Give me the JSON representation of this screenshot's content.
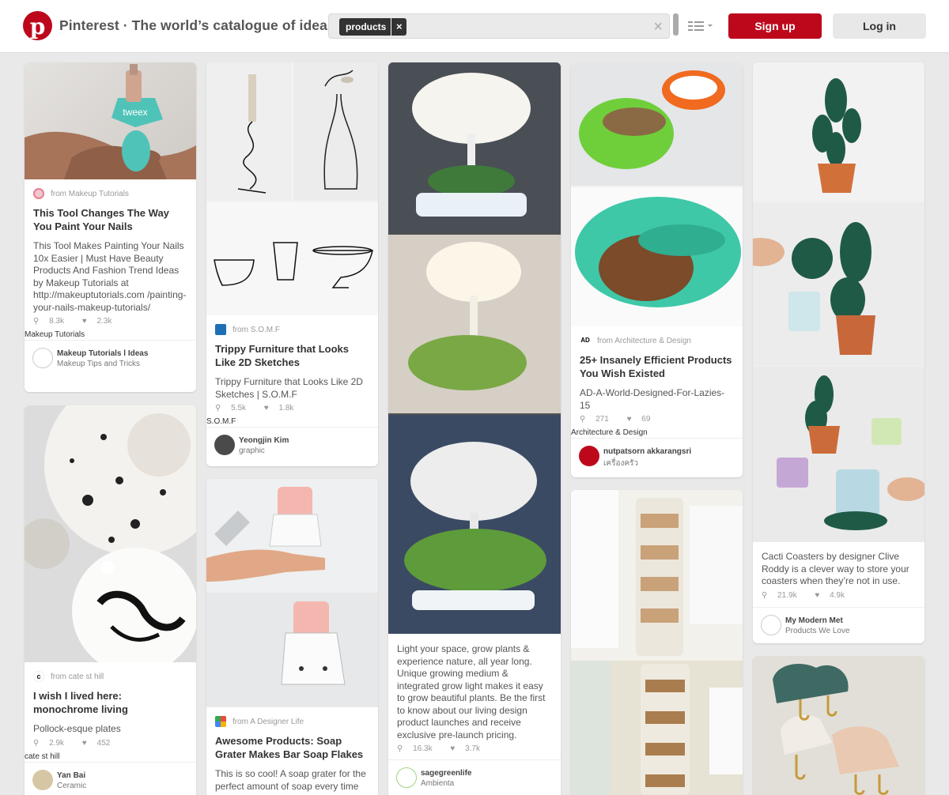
{
  "header": {
    "site_title": "Pinterest · The world’s catalogue of ideas",
    "search_token": "products",
    "token_remove": "×",
    "clear_search": "×",
    "signup_label": "Sign up",
    "login_label": "Log in",
    "brand_color": "#bd081c"
  },
  "pins": {
    "nails": {
      "source": "from Makeup Tutorials",
      "title": "This Tool Changes The Way You Paint Your Nails",
      "desc": "This Tool Makes Painting Your Nails 10x Easier | Must Have Beauty Products And Fashion Trend Ideas by Makeup Tutorials at http://makeuptutorials.com /painting-your-nails-makeup-tutorials/",
      "repins": "8.3k",
      "likes": "2.3k",
      "board_label": "Makeup Tutorials",
      "user_name": "Makeup Tutorials l Ideas",
      "user_board": "Makeup Tips and Tricks"
    },
    "plates": {
      "source": "from cate st hill",
      "title": "I wish I lived here: monochrome living",
      "desc": "Pollock-esque plates",
      "repins": "2.9k",
      "likes": "452",
      "board_label": "cate st hill",
      "user_name": "Yan Bai",
      "user_board": "Ceramic"
    },
    "furniture": {
      "source": "from S.O.M.F",
      "title": "Trippy Furniture that Looks Like 2D Sketches",
      "desc": "Trippy Furniture that Looks Like 2D Sketches | S.O.M.F",
      "repins": "5.5k",
      "likes": "1.8k",
      "board_label": "S.O.M.F",
      "user_name": "Yeongjin Kim",
      "user_board": "graphic"
    },
    "soap": {
      "source": "from A Designer Life",
      "title": "Awesome Products: Soap Grater Makes Bar Soap Flakes",
      "desc": "This is so cool! A soap grater for the perfect amount of soap every time"
    },
    "lamp": {
      "desc": "Light your space, grow plants & experience nature, all year long. Unique growing medium & integrated grow light makes it easy to grow beautiful plants. Be the first to know about our living design product launches and receive exclusive pre-launch pricing.",
      "repins": "16.3k",
      "likes": "3.7k",
      "user_name": "sagegreenlife",
      "user_board": "Ambienta"
    },
    "bowl": {
      "source": "from Architecture & Design",
      "title": "25+ Insanely Efficient Products You Wish Existed",
      "desc": "AD-A-World-Designed-For-Lazies-15",
      "repins": "271",
      "likes": "69",
      "board_label": "Architecture & Design",
      "user_name": "nutpatsorn akkarangsri",
      "user_board": "เครื่องครัว"
    },
    "cacti": {
      "desc": "Cacti Coasters by designer Clive Roddy is a clever way to store your coasters when they’re not in use.",
      "repins": "21.9k",
      "likes": "4.9k",
      "user_name": "My Modern Met",
      "user_board": "Products We Love"
    }
  },
  "icons": {
    "repin": "⚲",
    "like": "♥"
  }
}
